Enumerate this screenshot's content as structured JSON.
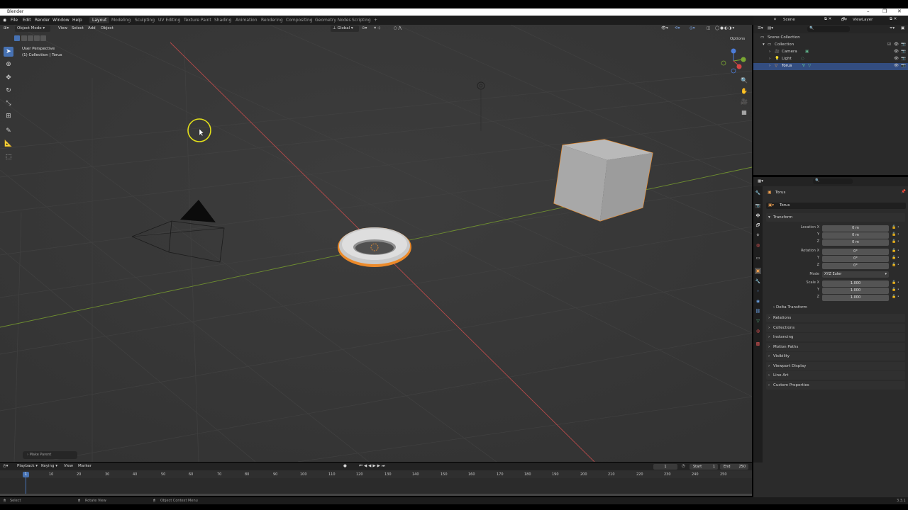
{
  "window": {
    "title": "Blender",
    "controls": [
      "–",
      "❐",
      "✕"
    ]
  },
  "menu": [
    "File",
    "Edit",
    "Render",
    "Window",
    "Help"
  ],
  "workspaces": [
    "Layout",
    "Modeling",
    "Sculpting",
    "UV Editing",
    "Texture Paint",
    "Shading",
    "Animation",
    "Rendering",
    "Compositing",
    "Geometry Nodes",
    "Scripting",
    "+"
  ],
  "active_workspace": "Layout",
  "scene": {
    "label": "Scene",
    "view_layer": "ViewLayer"
  },
  "viewport": {
    "mode": "Object Mode",
    "header_menus": [
      "View",
      "Select",
      "Add",
      "Object"
    ],
    "orientation": "Global",
    "options": "Options",
    "info_line1": "User Perspective",
    "info_line2": "(1) Collection | Torus",
    "make_parent": "Make Parent",
    "background": "#393939"
  },
  "outliner": {
    "rows": [
      {
        "label": "Scene Collection"
      },
      {
        "label": "Collection"
      },
      {
        "label": "Camera"
      },
      {
        "label": "Light"
      },
      {
        "label": "Torus"
      }
    ]
  },
  "properties": {
    "object_name": "Torus",
    "data_name": "Torus",
    "transform_title": "Transform",
    "location_label": "Location X",
    "rotation_label": "Rotation X",
    "scale_label": "Scale X",
    "y_label": "Y",
    "z_label": "Z",
    "mode_label": "Mode",
    "mode_value": "XYZ Euler",
    "location": [
      "0 m",
      "0 m",
      "0 m"
    ],
    "rotation": [
      "0°",
      "0°",
      "0°"
    ],
    "scale": [
      "1.000",
      "1.000",
      "1.000"
    ],
    "delta_transform": "Delta Transform",
    "panels": [
      "Relations",
      "Collections",
      "Instancing",
      "Motion Paths",
      "Visibility",
      "Viewport Display",
      "Line Art",
      "Custom Properties"
    ]
  },
  "timeline": {
    "menus": [
      "Playback",
      "Keying",
      "View",
      "Marker"
    ],
    "current_frame": "1",
    "start_label": "Start",
    "start": "1",
    "end_label": "End",
    "end": "250",
    "ticks": [
      "1",
      "10",
      "20",
      "30",
      "40",
      "50",
      "60",
      "70",
      "80",
      "90",
      "100",
      "110",
      "120",
      "130",
      "140",
      "150",
      "160",
      "170",
      "180",
      "190",
      "200",
      "210",
      "220",
      "230",
      "240",
      "250"
    ]
  },
  "status": {
    "select": "Select",
    "rotate": "Rotate View",
    "context": "Object Context Menu",
    "version": "3.3.1"
  },
  "colors": {
    "selection_orange": "#f08a24",
    "x_axis": "#b84a4a",
    "y_axis": "#6f8f30",
    "accent_blue": "#4772b3"
  }
}
